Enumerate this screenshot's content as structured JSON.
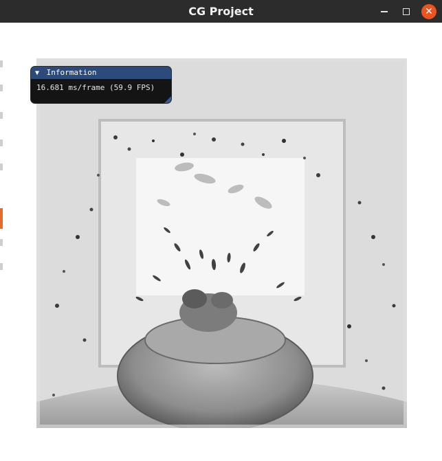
{
  "window": {
    "title": "CG Project",
    "controls": {
      "minimize": "minimize",
      "maximize": "maximize",
      "close": "close"
    }
  },
  "overlay": {
    "title": "Information",
    "fps_text": "16.681 ms/frame (59.9 FPS)"
  },
  "colors": {
    "titlebar": "#2c2c2c",
    "close_button": "#e95420",
    "imgui_header": "#2c4a7a",
    "imgui_background": "#141414"
  },
  "icons": {
    "collapse": "triangle-down-icon",
    "minimize": "minimize-icon",
    "maximize": "maximize-icon",
    "close": "close-icon"
  }
}
